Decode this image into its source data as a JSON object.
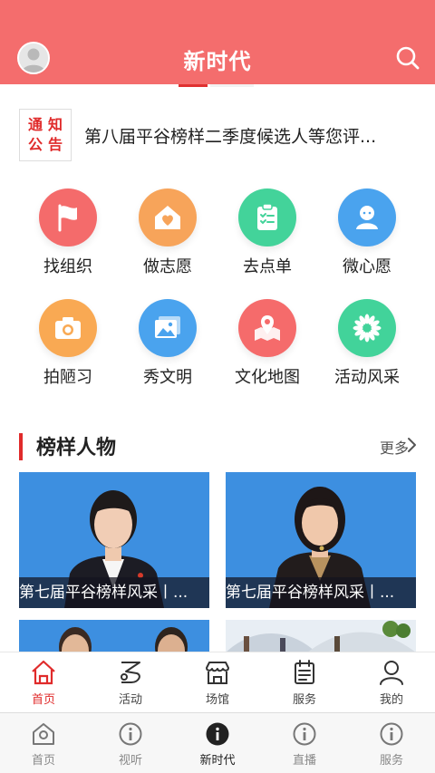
{
  "header": {
    "title": "新时代"
  },
  "notice": {
    "badge": [
      "通",
      "知",
      "公",
      "告"
    ],
    "text": "第八届平谷榜样二季度候选人等您评..."
  },
  "grid": [
    {
      "label": "找组织",
      "icon": "flag-icon",
      "color": "#f46b6b"
    },
    {
      "label": "做志愿",
      "icon": "heart-house-icon",
      "color": "#f7a45a"
    },
    {
      "label": "去点单",
      "icon": "clipboard-icon",
      "color": "#43d39a"
    },
    {
      "label": "微心愿",
      "icon": "person-icon",
      "color": "#4aa3ee"
    },
    {
      "label": "拍陋习",
      "icon": "camera-icon",
      "color": "#f9a953"
    },
    {
      "label": "秀文明",
      "icon": "gallery-icon",
      "color": "#4aa3ee"
    },
    {
      "label": "文化地图",
      "icon": "map-pin-icon",
      "color": "#f56b6b"
    },
    {
      "label": "活动风采",
      "icon": "flower-icon",
      "color": "#42d39a"
    }
  ],
  "section": {
    "title": "榜样人物",
    "more": "更多"
  },
  "cards": [
    {
      "caption": "第七届平谷榜样风采丨..."
    },
    {
      "caption": "第七届平谷榜样风采丨..."
    }
  ],
  "tabbar_app": [
    {
      "label": "首页",
      "icon": "home-icon",
      "active": true
    },
    {
      "label": "活动",
      "icon": "activity-icon",
      "active": false
    },
    {
      "label": "场馆",
      "icon": "venue-icon",
      "active": false
    },
    {
      "label": "服务",
      "icon": "service-icon",
      "active": false
    },
    {
      "label": "我的",
      "icon": "profile-icon",
      "active": false
    }
  ],
  "tabbar_main": [
    {
      "label": "首页",
      "icon": "home-icon",
      "active": false
    },
    {
      "label": "视听",
      "icon": "info-icon",
      "active": false
    },
    {
      "label": "新时代",
      "icon": "info-icon",
      "active": true
    },
    {
      "label": "直播",
      "icon": "info-icon",
      "active": false
    },
    {
      "label": "服务",
      "icon": "info-icon",
      "active": false
    }
  ],
  "colors": {
    "brand": "#f46d6d",
    "accent": "#e02b2b"
  }
}
